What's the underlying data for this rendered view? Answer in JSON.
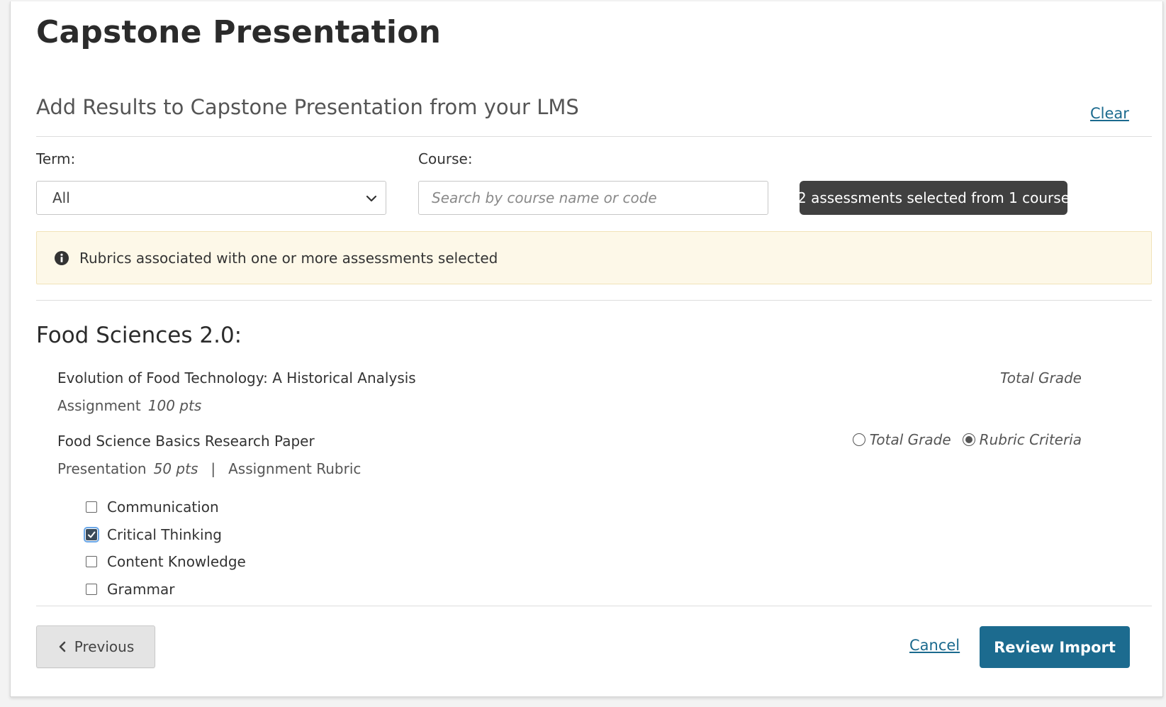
{
  "page": {
    "title": "Capstone Presentation"
  },
  "import": {
    "section_title": "Add Results to Capstone Presentation from your LMS",
    "clear_label": "Clear"
  },
  "filters": {
    "term": {
      "label": "Term:",
      "value": "All"
    },
    "course": {
      "label": "Course:",
      "placeholder": "Search by course name or code",
      "value": ""
    },
    "selection_badge": "2 assessments selected from 1 course"
  },
  "notice": {
    "icon": "info-icon",
    "text": "Rubrics associated with one or more assessments selected"
  },
  "course_group": {
    "title": "Food Sciences 2.0:",
    "assessments": [
      {
        "title": "Evolution of Food Technology: A Historical Analysis",
        "type": "Assignment",
        "points": "100 pts",
        "grade_label": "Total Grade"
      },
      {
        "title": "Food Science Basics Research Paper",
        "type": "Presentation",
        "points": "50 pts",
        "separator": "|",
        "rubric": "Assignment Rubric",
        "options": [
          {
            "label": "Total Grade",
            "selected": false
          },
          {
            "label": "Rubric Criteria",
            "selected": true
          }
        ],
        "criteria": [
          {
            "label": "Communication",
            "checked": false
          },
          {
            "label": "Critical Thinking",
            "checked": true
          },
          {
            "label": "Content Knowledge",
            "checked": false
          },
          {
            "label": "Grammar",
            "checked": false
          }
        ]
      }
    ]
  },
  "footer": {
    "previous_label": "Previous",
    "cancel_label": "Cancel",
    "review_label": "Review Import"
  },
  "colors": {
    "accent": "#1c6b8f",
    "link": "#1b6a8e",
    "badge_bg": "#404040",
    "notice_bg": "#fdf8e8"
  }
}
